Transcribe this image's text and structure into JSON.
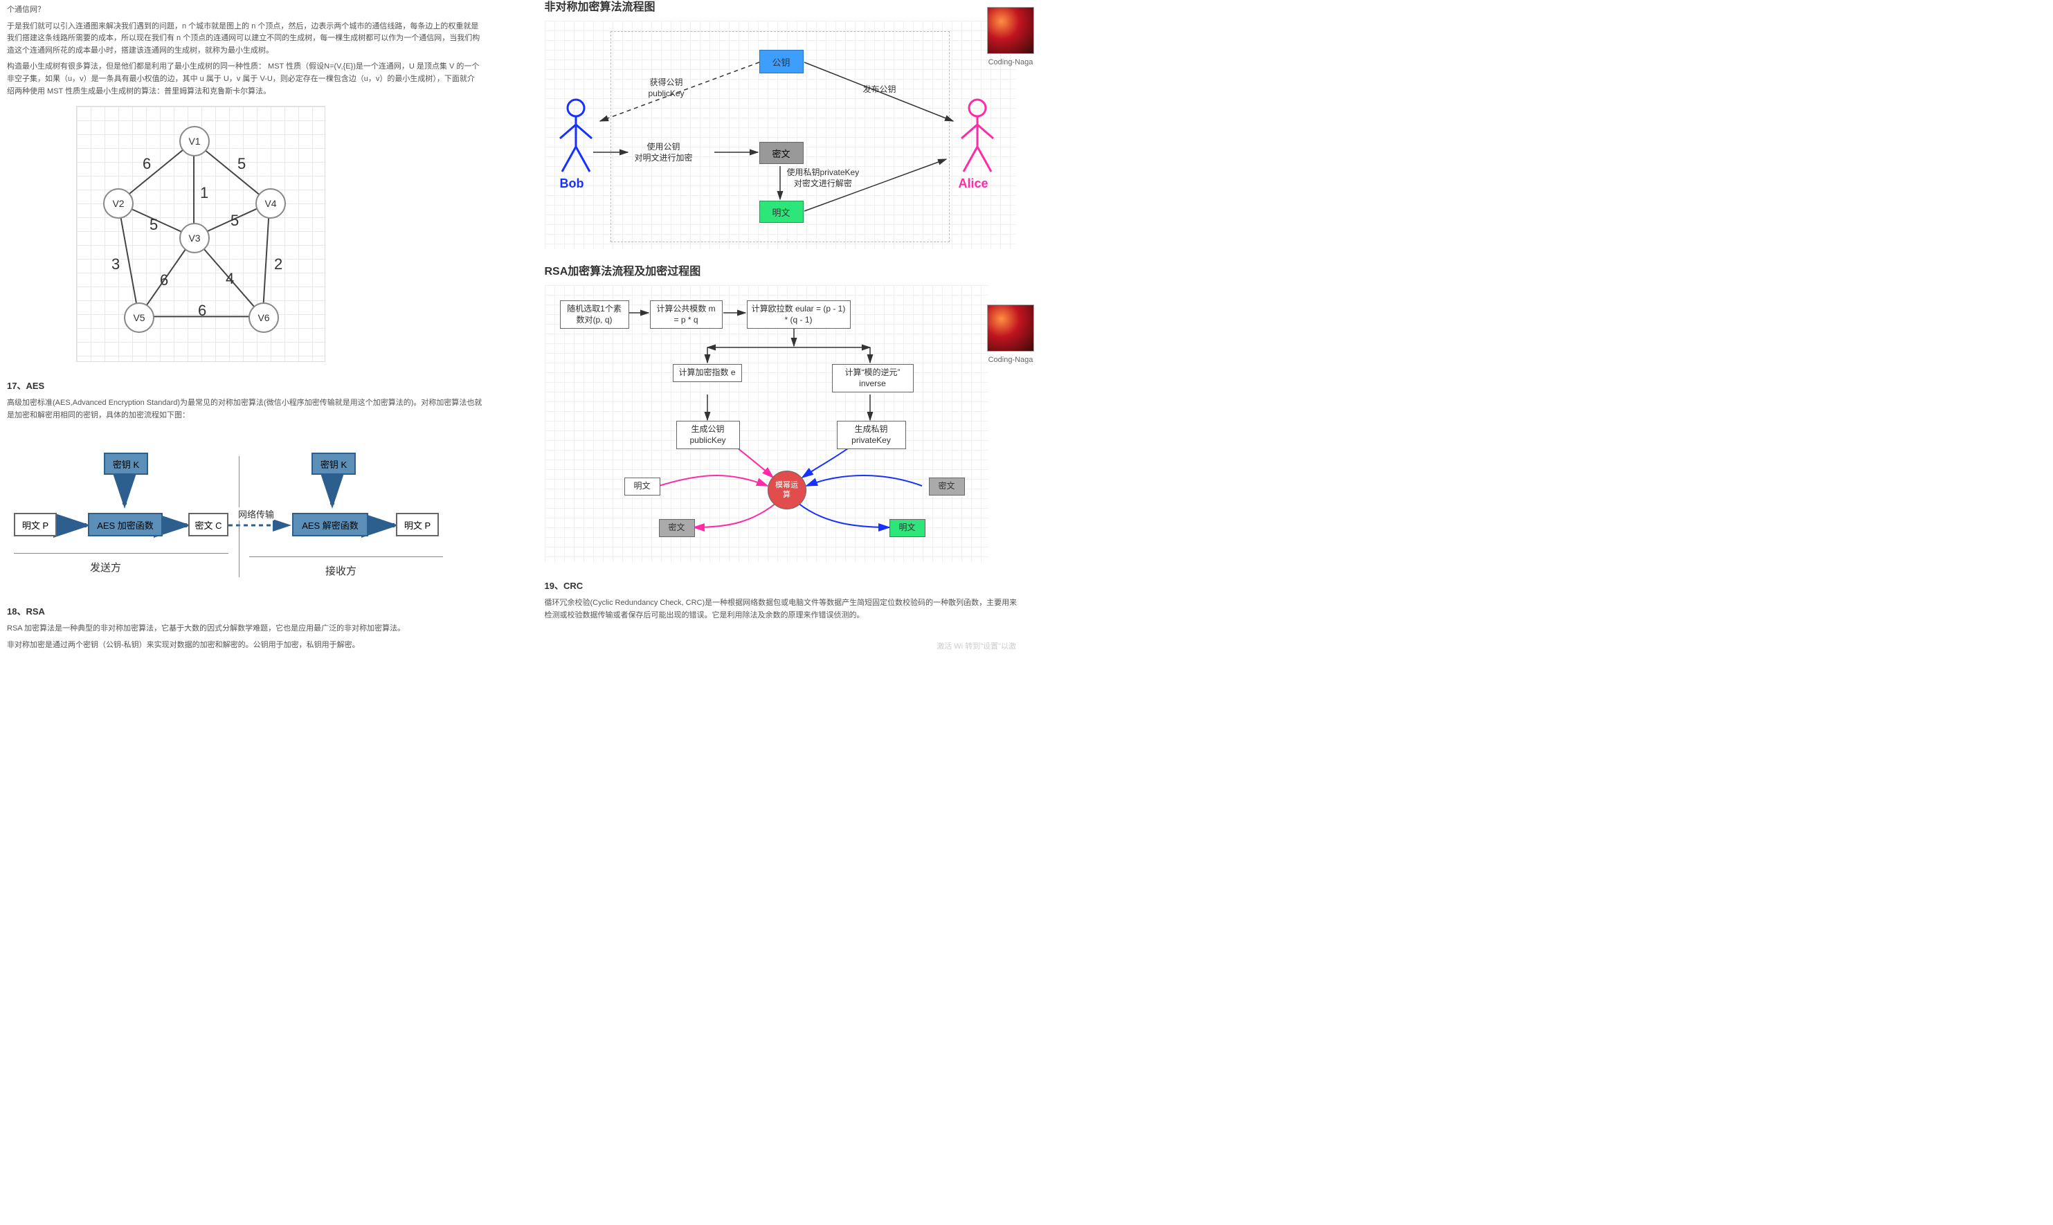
{
  "left": {
    "intro_tail": "个通信网？",
    "para1": "于是我们就可以引入连通图来解决我们遇到的问题，n 个城市就是图上的 n 个顶点，然后，边表示两个城市的通信线路，每条边上的权重就是我们搭建这条线路所需要的成本，所以现在我们有 n 个顶点的连通网可以建立不同的生成树，每一棵生成树都可以作为一个通信网，当我们构造这个连通网所花的成本最小时，搭建该连通网的生成树，就称为最小生成树。",
    "para2": "构造最小生成树有很多算法，但是他们都是利用了最小生成树的同一种性质： MST 性质（假设N=(V,{E})是一个连通网，U 是顶点集 V 的一个非空子集，如果（u，v）是一条具有最小权值的边，其中 u 属于 U，v 属于 V-U，则必定存在一棵包含边（u，v）的最小生成树），下面就介绍两种使用 MST 性质生成最小生成树的算法：普里姆算法和克鲁斯卡尔算法。",
    "mst": {
      "nodes": [
        "V1",
        "V2",
        "V3",
        "V4",
        "V5",
        "V6"
      ],
      "edges": {
        "v1v2": "6",
        "v1v3": "1",
        "v1v4": "5",
        "v2v3": "5",
        "v2v5": "3",
        "v3v4": "5",
        "v3v5": "6",
        "v3v6": "4",
        "v4v6": "2",
        "v5v6": "6"
      }
    },
    "aes": {
      "heading": "17、AES",
      "desc": "高级加密标准(AES,Advanced Encryption Standard)为最常见的对称加密算法(微信小程序加密传输就是用这个加密算法的)。对称加密算法也就是加密和解密用相同的密钥，具体的加密流程如下图：",
      "keyK": "密钥 K",
      "plainP": "明文 P",
      "cipherC": "密文  C",
      "encFn": "AES 加密函数",
      "decFn": "AES 解密函数",
      "net": "网络传输",
      "sender": "发送方",
      "receiver": "接收方"
    },
    "rsa": {
      "heading": "18、RSA",
      "line1": "RSA 加密算法是一种典型的非对称加密算法，它基于大数的因式分解数学难题，它也是应用最广泛的非对称加密算法。",
      "line2": "非对称加密是通过两个密钥（公钥-私钥）来实现对数据的加密和解密的。公钥用于加密，私钥用于解密。"
    }
  },
  "right": {
    "asym": {
      "title": "非对称加密算法流程图",
      "pubKey": "公钥",
      "getPub": "获得公钥\npublicKey",
      "issuePub": "发布公钥",
      "encLabel": "使用公钥\n对明文进行加密",
      "cipher": "密文",
      "decLabel": "使用私钥privateKey\n对密文进行解密",
      "plain": "明文",
      "bob": "Bob",
      "alice": "Alice"
    },
    "proc": {
      "title": "RSA加密算法流程及加密过程图",
      "randPQ": "随机选取1个素\n数对(p, q)",
      "modulus": "计算公共模数\nm = p * q",
      "eular": "计算欧拉数\neular = (p - 1) * (q - 1)",
      "expE": "计算加密指数\ne",
      "inverse": "计算“模的逆元”\ninverse",
      "genPub": "生成公钥\npublicKey",
      "genPriv": "生成私钥\nprivateKey",
      "plainL": "明文",
      "cipherR": "密文",
      "cipherL": "密文",
      "plainR": "明文",
      "modExp": "模幂运\n算"
    },
    "crc": {
      "heading": "19、CRC",
      "desc": "循环冗余校验(Cyclic Redundancy Check, CRC)是一种根据网络数据包或电脑文件等数据产生简短固定位数校验码的一种散列函数，主要用来检测或校验数据传输或者保存后可能出现的错误。它是利用除法及余数的原理来作错误侦测的。"
    },
    "author": "Coding-Naga",
    "watermark": "激活 Wi\n转到\"设置\"以激"
  },
  "chart_data": [
    {
      "type": "diagram",
      "title": "Weighted undirected graph for MST",
      "nodes": [
        "V1",
        "V2",
        "V3",
        "V4",
        "V5",
        "V6"
      ],
      "edges": [
        {
          "u": "V1",
          "v": "V2",
          "w": 6
        },
        {
          "u": "V1",
          "v": "V3",
          "w": 1
        },
        {
          "u": "V1",
          "v": "V4",
          "w": 5
        },
        {
          "u": "V2",
          "v": "V3",
          "w": 5
        },
        {
          "u": "V2",
          "v": "V5",
          "w": 3
        },
        {
          "u": "V3",
          "v": "V4",
          "w": 5
        },
        {
          "u": "V3",
          "v": "V5",
          "w": 6
        },
        {
          "u": "V3",
          "v": "V6",
          "w": 4
        },
        {
          "u": "V4",
          "v": "V6",
          "w": 2
        },
        {
          "u": "V5",
          "v": "V6",
          "w": 6
        }
      ]
    },
    {
      "type": "diagram",
      "title": "AES symmetric encryption flow",
      "flow": [
        "明文 P",
        "密钥 K",
        "AES 加密函数",
        "密文 C",
        "网络传输",
        "AES 解密函数",
        "密钥 K",
        "明文 P"
      ],
      "roles": {
        "left": "发送方",
        "right": "接收方"
      }
    },
    {
      "type": "diagram",
      "title": "非对称加密算法流程图 (Asymmetric encryption)",
      "actors": [
        "Bob",
        "Alice"
      ],
      "steps": [
        "Alice 发布公钥",
        "Bob 获得公钥 publicKey",
        "Bob 使用公钥对明文进行加密 → 密文",
        "Alice 使用私钥 privateKey 对密文进行解密 → 明文"
      ]
    },
    {
      "type": "diagram",
      "title": "RSA加密算法流程及加密过程图",
      "nodes": [
        "随机选取1个素数对(p,q)",
        "计算公共模数 m = p*q",
        "计算欧拉数 eular = (p-1)*(q-1)",
        "计算加密指数 e",
        "计算“模的逆元” inverse",
        "生成公钥 publicKey",
        "生成私钥 privateKey",
        "模幂运算",
        "明文",
        "密文"
      ]
    }
  ]
}
